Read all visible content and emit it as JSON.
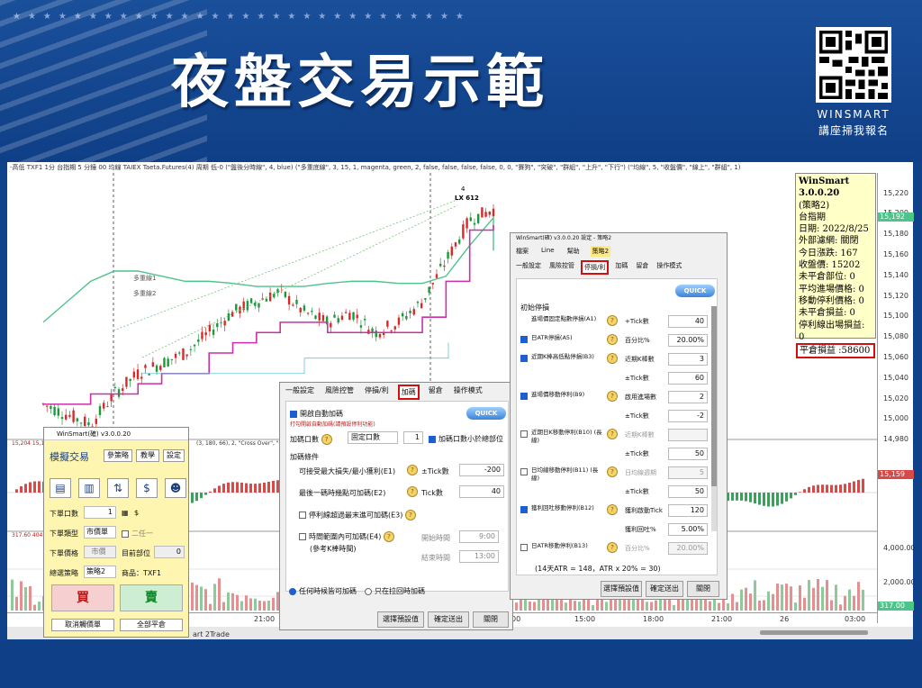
{
  "banner": {
    "title": "夜盤交易示範",
    "brand": "WINSMART",
    "brand_sub": "講座掃我報名"
  },
  "chart": {
    "topbar_text": "-高低   TXF1  1分  台指期  5 分鐘  00  均線  TAIEX  Taeta.Futures(4)  周期  低-0  (\"盤後分時線\", 4, blue)  (\"多重底線\", 3, 15, 1, magenta, green, 2, false, false, false, false, 0, 0, \"賽狗\", \"突破\", \"群組\", \"上升\", \"下行\")  (\"均線\", 5, \"收盤價\", \"線上\", \"群組\", 1)",
    "price_ticks": [
      "15,220",
      "15,200",
      "15,180",
      "15,160",
      "15,140",
      "15,120",
      "15,100",
      "15,080",
      "15,060",
      "15,040",
      "15,020",
      "15,000",
      "14,980"
    ],
    "price_marker_1": "15,192",
    "price_marker_2": "15,159",
    "lower_ticks": [
      "4,000.00",
      "2,000.00"
    ],
    "lower_marker": "317.00",
    "time_ticks": [
      "21:00",
      "00",
      "15:00",
      "18:00",
      "21:00",
      "26",
      "03:00"
    ],
    "overlay_labels": [
      "多重線1",
      "多重線2"
    ],
    "lower_header": "15,204  15,159",
    "lower_header2": "(3, 180, 66), 2, \"Cross Over\", \"Cross Ov",
    "lower_left_vals": "317.60  404.4",
    "peak_label": "LX 612",
    "peak_num": "4"
  },
  "info_box": {
    "lines": [
      "WinSmart 3.0.0.20",
      "(策略2)",
      "台指期",
      "日期: 2022/8/25",
      "外部濾網: 關閉",
      "今日漲跌: 167",
      "收盤價: 15202",
      "未平倉部位: 0",
      "平均進場價格: 0",
      "移動停利價格: 0",
      "未平倉損益: 0",
      "停利線出場損益: 0"
    ],
    "total_pnl": "平倉損益 :58600"
  },
  "add_dialog": {
    "tabs": [
      "一般設定",
      "風險控管",
      "停損/利",
      "加碼",
      "留倉",
      "操作模式"
    ],
    "active_tab": "加碼",
    "quick_start": "QUICK START",
    "enable_label": "開啟自動加碼",
    "enable_note": "打勾開啟自動加碼(請預設停利功能)",
    "add_qty_label": "加碼口數",
    "add_mode": "固定口數",
    "add_qty": "1",
    "follow_label": "加碼口數小於總部位",
    "conditions_header": "加碼條件",
    "cond1_label": "可接受最大損失/最小獲利(E1)",
    "cond1_unit": "±Tick數",
    "cond1_value": "-200",
    "cond2_label": "最後一碼時幾點可加碼(E2)",
    "cond2_unit": "Tick數",
    "cond2_value": "40",
    "cond3_label": "停利線超過最末進可加碼(E3)",
    "cond4_label": "時間範圍內可加碼(E4)",
    "cond4_sub": "(參考K棒時間)",
    "start_time_label": "開始時間",
    "start_time": "9:00",
    "end_time_label": "結束時間",
    "end_time": "13:00",
    "radio1": "任何時候皆可加碼",
    "radio2": "只在拉回時加碼",
    "btn_defaults": "選擇預設值",
    "btn_ok": "確定送出",
    "btn_close": "關閉"
  },
  "stop_dialog": {
    "title": "WinSmart(確) v3.0.0.20 設定 - 策略2",
    "menu": [
      "檔案",
      "Line",
      "幫助",
      "策略2"
    ],
    "tabs": [
      "一般設定",
      "風險控管",
      "停損/利",
      "加碼",
      "留倉",
      "操作模式"
    ],
    "active_tab": "停損/利",
    "quick_start": "QUICK START",
    "section": "初始停損",
    "rows": [
      {
        "label": "進場價固定點數停損(A1)",
        "unit": "+Tick數",
        "value": "40",
        "checked": null
      },
      {
        "label": "日ATR停損(A5)",
        "unit": "百分比%",
        "value": "20.00%",
        "checked": true
      },
      {
        "label": "近期K棒高低點停損(B3)",
        "unit": "近期K棒數",
        "value": "3",
        "checked": true
      },
      {
        "label": "",
        "unit": "±Tick數",
        "value": "60",
        "checked": null
      },
      {
        "label": "進場價移動停利(B9)",
        "unit": "啟用進場數",
        "value": "2",
        "checked": true
      },
      {
        "label": "",
        "unit": "±Tick數",
        "value": "-2",
        "checked": null
      },
      {
        "label": "近期日K移動停利(B10) (長線)",
        "unit": "近期K棒數",
        "value": "",
        "checked": false
      },
      {
        "label": "",
        "unit": "±Tick數",
        "value": "50",
        "checked": null
      },
      {
        "label": "日均線移動停利(B11) (長線)",
        "unit": "日均線週期",
        "value": "5",
        "checked": false
      },
      {
        "label": "",
        "unit": "±Tick數",
        "value": "50",
        "checked": null
      },
      {
        "label": "獲利回吐移動停利(B12)",
        "unit": "獲利啟動Tick",
        "value": "120",
        "checked": true
      },
      {
        "label": "",
        "unit": "獲利回吐%",
        "value": "5.00%",
        "checked": null
      },
      {
        "label": "日ATR移動停利(B13)",
        "unit": "百分比%",
        "value": "20.00%",
        "checked": false
      }
    ],
    "note": "(14天ATR = 148，ATR x 20% = 30)",
    "btn_defaults": "選擇預設值",
    "btn_ok": "確定送出",
    "btn_close": "關閉"
  },
  "trade_panel": {
    "title": "WinSmart(確) v3.0.0.20",
    "mode": "模擬交易",
    "btn_params": "參策略",
    "btn_teach": "教學",
    "btn_settings": "設定",
    "qty_label": "下單口數",
    "qty_value": "1",
    "order_type_label": "下單類型",
    "order_type": "市價單",
    "order_type_extra": "二任一",
    "price_label": "下單價格",
    "price_value": "市價",
    "position_label": "目前部位",
    "position_value": "0",
    "strategy_label": "總選策略",
    "strategy_value": "策略2",
    "product_label": "商品：TXF1",
    "buy": "買",
    "sell": "賣",
    "cancel_btn": "取消觸價單",
    "flatten_btn": "全部平倉",
    "footer": "art 2Trade"
  },
  "chart_data": {
    "type": "line",
    "series": [
      {
        "values": [
          15010,
          15000,
          14990,
          15020,
          15040,
          15050,
          15060,
          15080,
          15100,
          15110,
          15120,
          15100,
          15090,
          15100,
          15080,
          15090,
          15110,
          15150,
          15190,
          15200
        ]
      }
    ]
  }
}
